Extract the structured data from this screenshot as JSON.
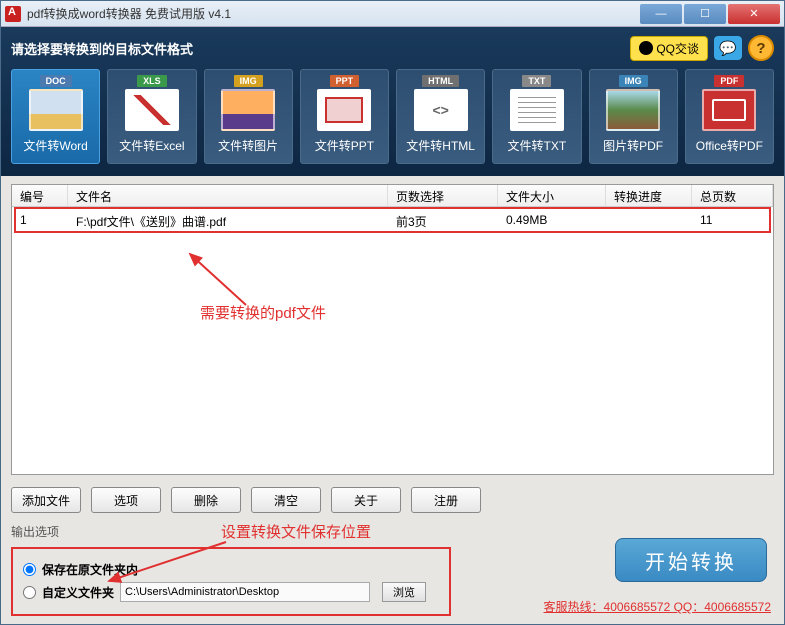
{
  "titlebar": {
    "title": "pdf转换成word转换器 免费试用版 v4.1"
  },
  "header": {
    "label": "请选择要转换到的目标文件格式",
    "qq": "QQ交谈",
    "help": "?"
  },
  "formats": [
    {
      "tag": "DOC",
      "label": "文件转Word"
    },
    {
      "tag": "XLS",
      "label": "文件转Excel"
    },
    {
      "tag": "IMG",
      "label": "文件转图片"
    },
    {
      "tag": "PPT",
      "label": "文件转PPT"
    },
    {
      "tag": "HTML",
      "label": "文件转HTML"
    },
    {
      "tag": "TXT",
      "label": "文件转TXT"
    },
    {
      "tag": "IMG",
      "label": "图片转PDF"
    },
    {
      "tag": "PDF",
      "label": "Office转PDF"
    }
  ],
  "table": {
    "headers": {
      "num": "编号",
      "name": "文件名",
      "pages": "页数选择",
      "size": "文件大小",
      "prog": "转换进度",
      "total": "总页数"
    },
    "rows": [
      {
        "num": "1",
        "name": "F:\\pdf文件\\《送别》曲谱.pdf",
        "pages": "前3页",
        "size": "0.49MB",
        "prog": "",
        "total": "11"
      }
    ]
  },
  "annotations": {
    "file_note": "需要转换的pdf文件",
    "save_note": "设置转换文件保存位置"
  },
  "buttons": {
    "add": "添加文件",
    "options": "选项",
    "delete": "删除",
    "clear": "清空",
    "about": "关于",
    "register": "注册"
  },
  "output": {
    "section_label": "输出选项",
    "opt_same": "保存在原文件夹内",
    "opt_custom": "自定义文件夹",
    "path": "C:\\Users\\Administrator\\Desktop",
    "browse": "浏览"
  },
  "start": "开始转换",
  "service": "客服热线：4006685572 QQ：4006685572"
}
